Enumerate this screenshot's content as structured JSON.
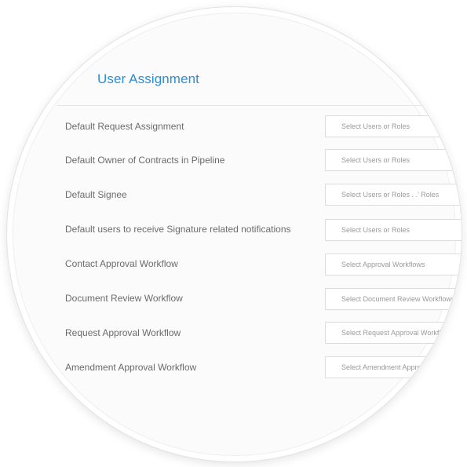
{
  "section": {
    "title": "User Assignment"
  },
  "rows": [
    {
      "label": "Default Request Assignment",
      "placeholder": "Select Users or Roles"
    },
    {
      "label": "Default Owner of Contracts in Pipeline",
      "placeholder": "Select Users or Roles"
    },
    {
      "label": "Default Signee",
      "placeholder": "Select Users or Roles  . .’ Roles"
    },
    {
      "label": "Default users to receive Signature related notifications",
      "placeholder": "Select Users or Roles"
    },
    {
      "label": "Contact Approval Workflow",
      "placeholder": "Select Approval Workflows"
    },
    {
      "label": "Document Review Workflow",
      "placeholder": "Select Document Review Workflows"
    },
    {
      "label": "Request Approval Workflow",
      "placeholder": "Select Request Approval Workflows"
    },
    {
      "label": "Amendment Approval Workflow",
      "placeholder": "Select Amendment Approval Workflows"
    }
  ]
}
